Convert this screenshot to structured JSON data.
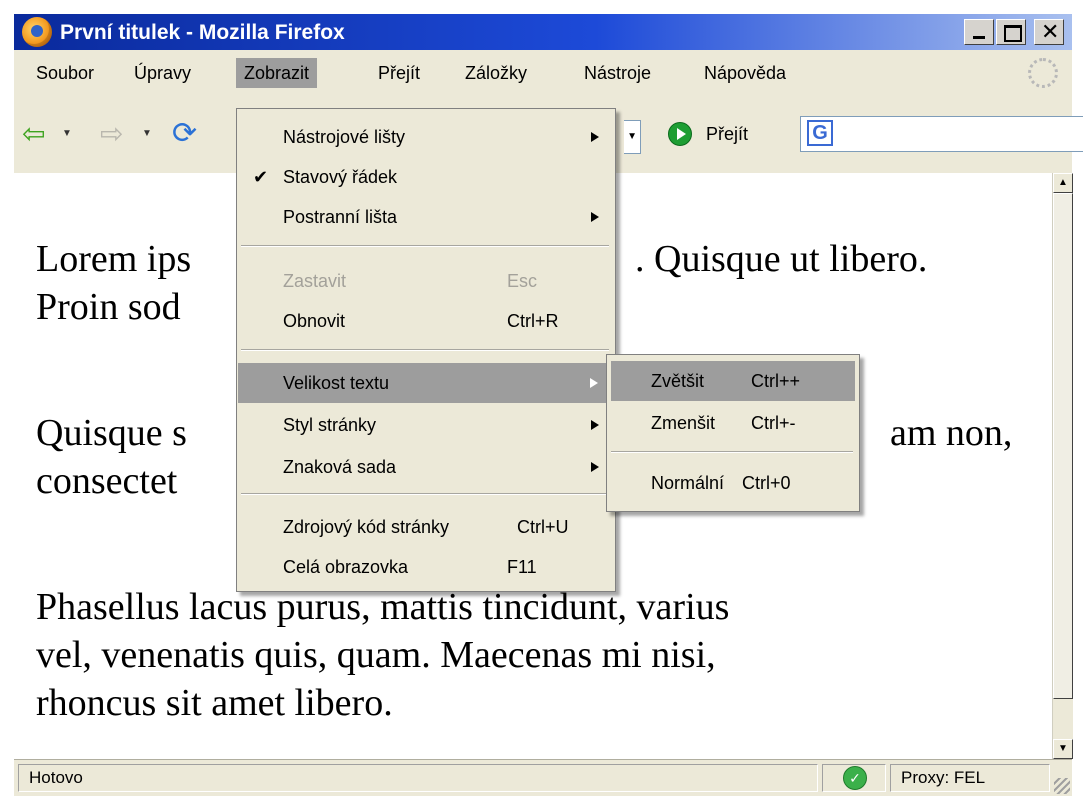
{
  "window": {
    "title": "První titulek - Mozilla Firefox"
  },
  "menubar": {
    "items": [
      "Soubor",
      "Úpravy",
      "Zobrazit",
      "Přejít",
      "Záložky",
      "Nástroje",
      "Nápověda"
    ],
    "active": "Zobrazit"
  },
  "navbar": {
    "go_label": "Přejít"
  },
  "content": {
    "paragraphs": [
      "Lorem ipsum dolor sit amet. Quisque ut libero. Proin sodales.",
      "Quisque sit amet est nec diam non, consectetuer adipiscing.",
      "Phasellus lacus purus, mattis tincidunt, varius vel, venenatis quis, quam. Maecenas mi nisi, rhoncus sit amet libero."
    ],
    "visible_lines": {
      "p1_line1_left": "Lorem ips",
      "p1_line1_right": ". Quisque ut libero.",
      "p1_line2_left": "Proin sod",
      "p2_line1_left": "Quisque s",
      "p2_line1_right": "am non,",
      "p2_line2_left": "consectet",
      "p3_line1": "Phasellus lacus purus, mattis tincidunt, varius",
      "p3_line2": "vel, venenatis quis, quam. Maecenas mi nisi,",
      "p3_line3": "rhoncus sit amet libero."
    }
  },
  "view_menu": {
    "items": [
      {
        "label": "Nástrojové lišty",
        "submenu": true
      },
      {
        "label": "Stavový řádek",
        "checked": true
      },
      {
        "label": "Postranní lišta",
        "submenu": true
      },
      {
        "label": "Zastavit",
        "shortcut": "Esc",
        "disabled": true
      },
      {
        "label": "Obnovit",
        "shortcut": "Ctrl+R"
      },
      {
        "label": "Velikost textu",
        "submenu": true,
        "highlighted": true
      },
      {
        "label": "Styl stránky",
        "submenu": true
      },
      {
        "label": "Znaková sada",
        "submenu": true
      },
      {
        "label": "Zdrojový kód stránky",
        "shortcut": "Ctrl+U"
      },
      {
        "label": "Celá obrazovka",
        "shortcut": "F11"
      }
    ]
  },
  "text_size_menu": {
    "items": [
      {
        "label": "Zvětšit",
        "shortcut": "Ctrl++",
        "highlighted": true
      },
      {
        "label": "Zmenšit",
        "shortcut": "Ctrl+-"
      },
      {
        "label": "Normální",
        "shortcut": "Ctrl+0"
      }
    ]
  },
  "statusbar": {
    "status": "Hotovo",
    "proxy": "Proxy: FEL"
  },
  "colors": {
    "titlebar_start": "#0a2a9c",
    "menu_background": "#ece9d8",
    "highlight": "#9d9d9d"
  }
}
